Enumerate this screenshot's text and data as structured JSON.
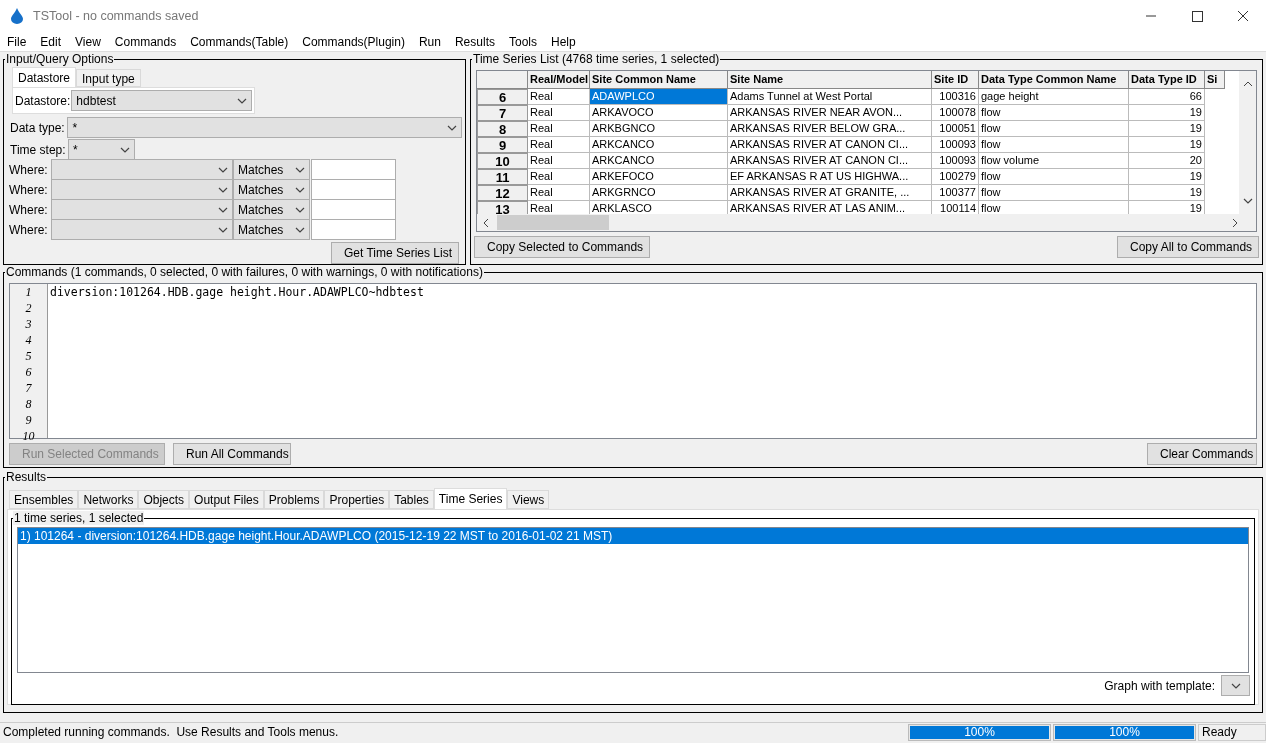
{
  "window": {
    "title": "TSTool - no commands saved"
  },
  "menu": [
    "File",
    "Edit",
    "View",
    "Commands",
    "Commands(Table)",
    "Commands(Plugin)",
    "Run",
    "Results",
    "Tools",
    "Help"
  ],
  "query": {
    "title": "Input/Query Options",
    "tabs": [
      {
        "label": "Datastore",
        "selected": true
      },
      {
        "label": "Input type",
        "selected": false
      }
    ],
    "datastore": {
      "label": "Datastore:",
      "value": "hdbtest"
    },
    "data_type": {
      "label": "Data type:",
      "value": "*"
    },
    "time_step": {
      "label": "Time step:",
      "value": "*"
    },
    "where_rows": [
      {
        "label": "Where:",
        "operator": "Matches"
      },
      {
        "label": "Where:",
        "operator": "Matches"
      },
      {
        "label": "Where:",
        "operator": "Matches"
      },
      {
        "label": "Where:",
        "operator": "Matches"
      }
    ],
    "button": "Get Time Series List"
  },
  "ts_list": {
    "title": "Time Series List (4768 time series, 1 selected)",
    "columns": [
      "Real/Model",
      "Site Common Name",
      "Site Name",
      "Site ID",
      "Data Type Common Name",
      "Data Type ID",
      "Si"
    ],
    "rows": [
      {
        "num": "6",
        "cells": [
          "Real",
          "ADAWPLCO",
          "Adams Tunnel at West Portal",
          "100316",
          "gage height",
          "66"
        ],
        "selected": true
      },
      {
        "num": "7",
        "cells": [
          "Real",
          "ARKAVOCO",
          "ARKANSAS RIVER NEAR AVON...",
          "100078",
          "flow",
          "19"
        ],
        "selected": false
      },
      {
        "num": "8",
        "cells": [
          "Real",
          "ARKBGNCO",
          "ARKANSAS RIVER BELOW GRA...",
          "100051",
          "flow",
          "19"
        ],
        "selected": false
      },
      {
        "num": "9",
        "cells": [
          "Real",
          "ARKCANCO",
          "ARKANSAS RIVER AT CANON CI...",
          "100093",
          "flow",
          "19"
        ],
        "selected": false
      },
      {
        "num": "10",
        "cells": [
          "Real",
          "ARKCANCO",
          "ARKANSAS RIVER AT CANON CI...",
          "100093",
          "flow volume",
          "20"
        ],
        "selected": false
      },
      {
        "num": "11",
        "cells": [
          "Real",
          "ARKEFOCO",
          "EF ARKANSAS R AT US HIGHWA...",
          "100279",
          "flow",
          "19"
        ],
        "selected": false
      },
      {
        "num": "12",
        "cells": [
          "Real",
          "ARKGRNCO",
          "ARKANSAS RIVER AT GRANITE, ...",
          "100377",
          "flow",
          "19"
        ],
        "selected": false
      },
      {
        "num": "13",
        "cells": [
          "Real",
          "ARKLASCO",
          "ARKANSAS RIVER AT LAS ANIM...",
          "100114",
          "flow",
          "19"
        ],
        "selected": false
      }
    ],
    "buttons": [
      "Copy Selected to Commands",
      "Copy All to Commands"
    ]
  },
  "commands": {
    "title": "Commands (1 commands, 0 selected, 0 with failures, 0 with warnings, 0 with notifications)",
    "line_numbers": [
      "1",
      "2",
      "3",
      "4",
      "5",
      "6",
      "7",
      "8",
      "9",
      "10"
    ],
    "lines": [
      "diversion:101264.HDB.gage height.Hour.ADAWPLCO~hdbtest"
    ],
    "buttons": [
      {
        "label": "Run Selected Commands",
        "disabled": true
      },
      {
        "label": "Run All Commands",
        "disabled": false
      },
      {
        "label": "Clear Commands",
        "disabled": false
      }
    ]
  },
  "results": {
    "title": "Results",
    "tabs": [
      {
        "label": "Ensembles",
        "selected": false
      },
      {
        "label": "Networks",
        "selected": false
      },
      {
        "label": "Objects",
        "selected": false
      },
      {
        "label": "Output Files",
        "selected": false
      },
      {
        "label": "Problems",
        "selected": false
      },
      {
        "label": "Properties",
        "selected": false
      },
      {
        "label": "Tables",
        "selected": false
      },
      {
        "label": "Time Series",
        "selected": true
      },
      {
        "label": "Views",
        "selected": false
      }
    ],
    "list_title": "1 time series, 1 selected",
    "items": [
      {
        "text": "1) 101264 - diversion:101264.HDB.gage height.Hour.ADAWPLCO (2015-12-19 22 MST to 2016-01-02 21 MST)",
        "selected": true
      }
    ],
    "graph_label": "Graph with template:"
  },
  "status_bar": {
    "message": "Completed running commands.  Use Results and Tools menus.",
    "progress": [
      {
        "level": 1,
        "reading": "100%"
      },
      {
        "level": 1,
        "reading": "100%"
      }
    ],
    "state": "Ready"
  }
}
